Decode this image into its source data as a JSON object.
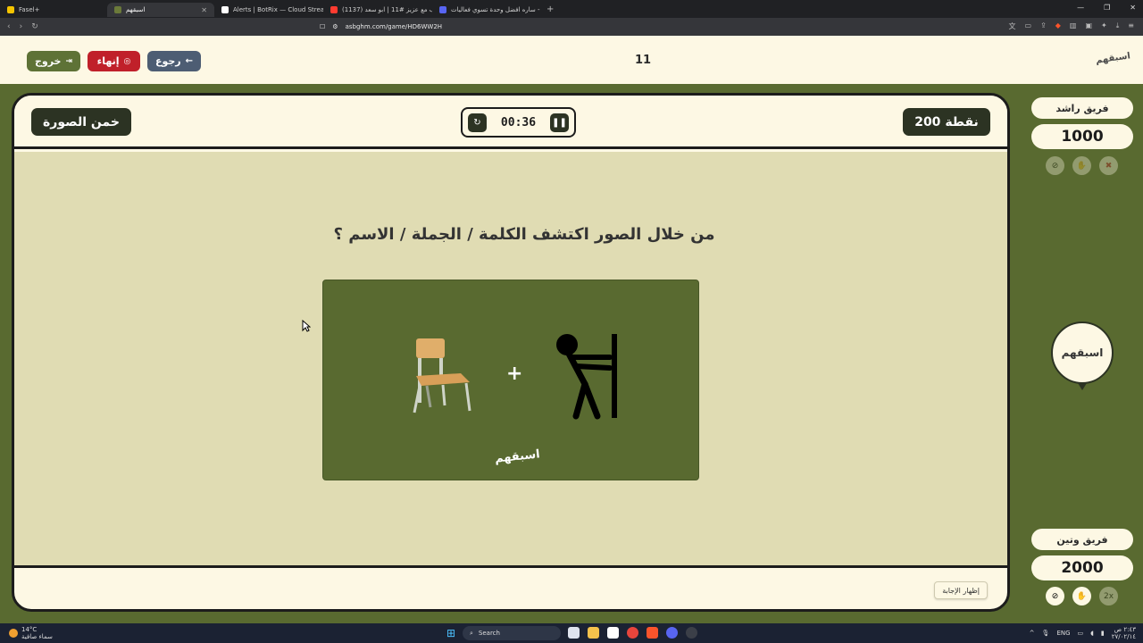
{
  "browser": {
    "tabs": [
      {
        "label": "Fasel+",
        "color": "#f5c400"
      },
      {
        "label": "اسبقهم",
        "active": true,
        "color": "#6b7a3a"
      },
      {
        "label": "Alerts | BotRix — Cloud Streaming B...",
        "color": "#ffffff"
      },
      {
        "label": "(1137) حروف مع عزيز #11 | ابو سعد...",
        "color": "#ff3b30"
      },
      {
        "label": "ساره افضل وحدة تسوي فعاليات - rion",
        "color": "#5865f2"
      }
    ],
    "url": "asbghm.com/game/HD6WW2H"
  },
  "game": {
    "exit_label": "خروج",
    "end_label": "إنهاء",
    "back_label": "رجوع",
    "round_number": "11",
    "logo_text": "اسبقهم",
    "points_label": "200 نقطة",
    "timer": "00:36",
    "category_label": "خمن الصورة",
    "question": "من خلال الصور اكتشف الكلمة / الجملة / الاسم ؟",
    "image_plus": "+",
    "image_watermark": "اسبقهم",
    "show_answer_label": "إظهار الإجابة",
    "turn_bubble_text": "اسبقهم"
  },
  "teams": [
    {
      "name": "فريق راشد",
      "score": "1000"
    },
    {
      "name": "فريق وتين",
      "score": "2000"
    }
  ],
  "taskbar": {
    "weather_temp": "14°C",
    "weather_desc": "سماء صافية",
    "search_placeholder": "Search",
    "lang": "ENG",
    "time": "٢:٤٣ ص",
    "date": "٢٧/٠٢/١٤"
  },
  "colors": {
    "exit_button": "#5e7236",
    "end_button": "#c0202a",
    "back_button": "#4d5d73",
    "field_green": "#596a30",
    "cream": "#fdf8e4",
    "dark_pill": "#2c3323"
  }
}
